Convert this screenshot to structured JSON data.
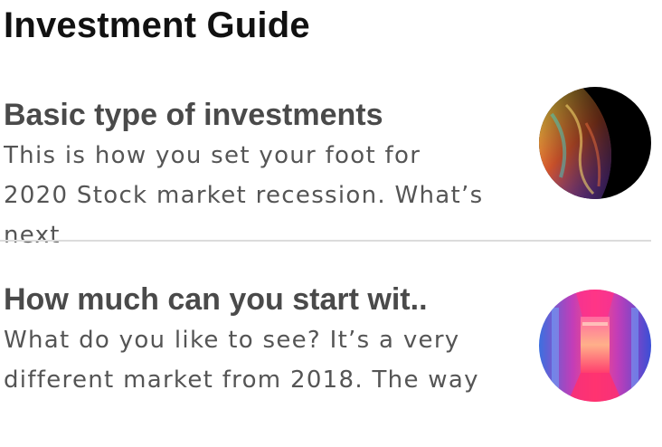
{
  "header": {
    "title": "Investment Guide"
  },
  "articles": [
    {
      "title": "Basic type of investments",
      "description": "This is how you set your foot for 2020 Stock market recession. What’s next",
      "thumbnail_icon": "planet-image"
    },
    {
      "title": "How much can you start wit..",
      "description": "What do you like to see? It’s a very different market from 2018. The way",
      "thumbnail_icon": "neon-corridor-image"
    }
  ],
  "colors": {
    "title": "#111111",
    "card_title": "#4a4a4a",
    "card_text": "#555555",
    "divider": "#dcdcdc"
  }
}
